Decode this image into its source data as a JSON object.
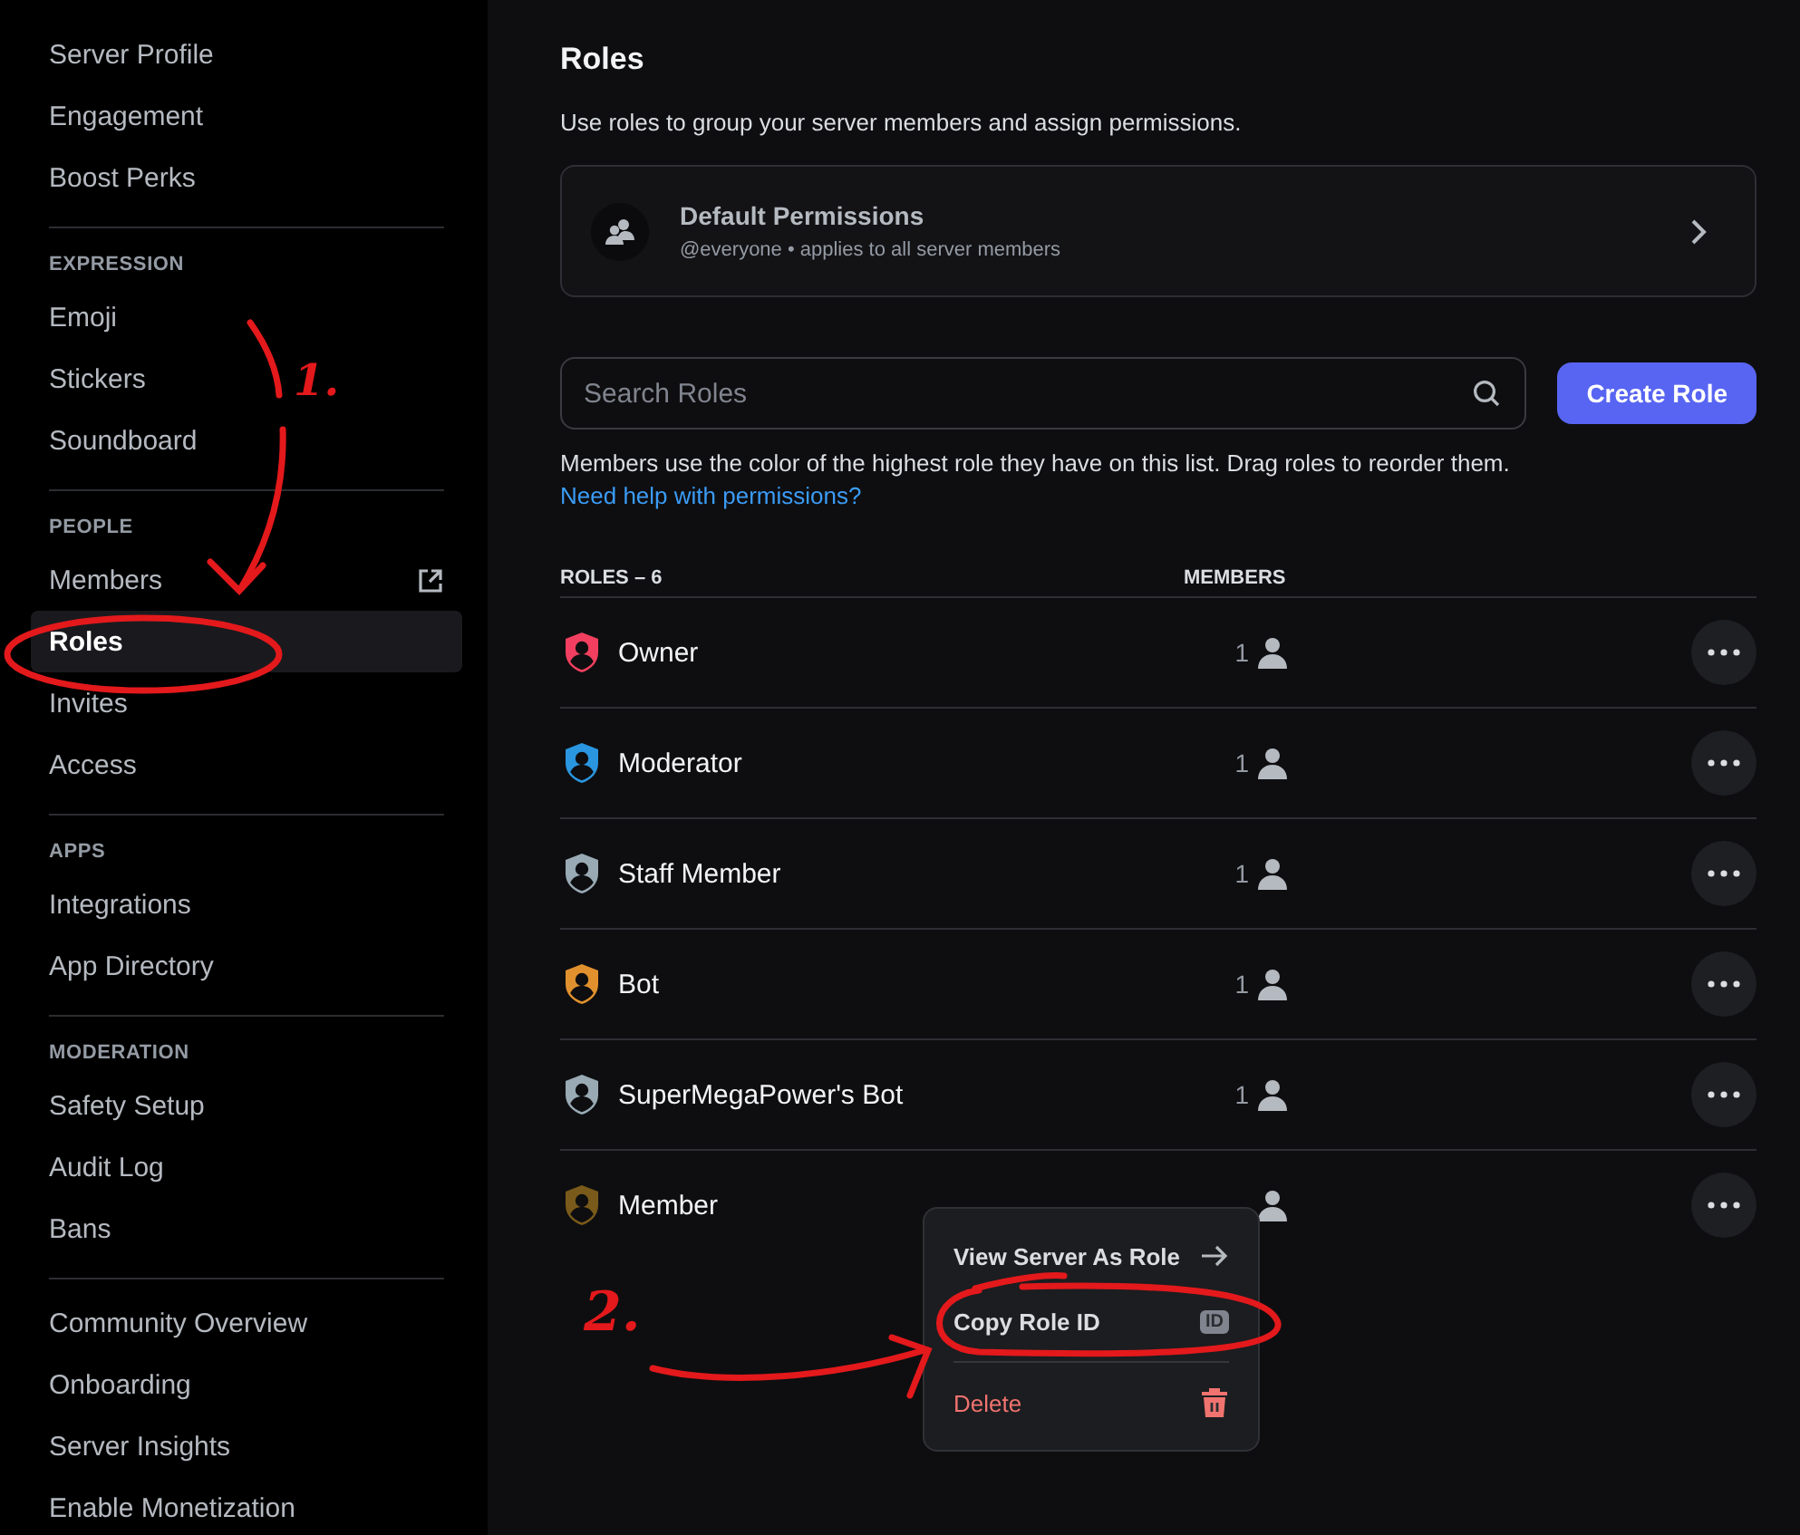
{
  "sidebar": {
    "groups": [
      {
        "items": [
          {
            "label": "Server Profile",
            "kind": "page",
            "selected": false
          },
          {
            "label": "Engagement",
            "kind": "page",
            "selected": false
          },
          {
            "label": "Boost Perks",
            "kind": "page",
            "selected": false
          }
        ]
      },
      {
        "header": "EXPRESSION",
        "items": [
          {
            "label": "Emoji",
            "kind": "page",
            "selected": false
          },
          {
            "label": "Stickers",
            "kind": "page",
            "selected": false
          },
          {
            "label": "Soundboard",
            "kind": "page",
            "selected": false
          }
        ]
      },
      {
        "header": "PEOPLE",
        "items": [
          {
            "label": "Members",
            "kind": "external",
            "selected": false
          },
          {
            "label": "Roles",
            "kind": "page",
            "selected": true
          },
          {
            "label": "Invites",
            "kind": "page",
            "selected": false
          },
          {
            "label": "Access",
            "kind": "page",
            "selected": false
          }
        ]
      },
      {
        "header": "APPS",
        "items": [
          {
            "label": "Integrations",
            "kind": "page",
            "selected": false
          },
          {
            "label": "App Directory",
            "kind": "page",
            "selected": false
          }
        ]
      },
      {
        "header": "MODERATION",
        "items": [
          {
            "label": "Safety Setup",
            "kind": "page",
            "selected": false
          },
          {
            "label": "Audit Log",
            "kind": "page",
            "selected": false
          },
          {
            "label": "Bans",
            "kind": "page",
            "selected": false
          }
        ]
      },
      {
        "items": [
          {
            "label": "Community Overview",
            "kind": "page",
            "selected": false
          },
          {
            "label": "Onboarding",
            "kind": "page",
            "selected": false
          },
          {
            "label": "Server Insights",
            "kind": "page",
            "selected": false
          },
          {
            "label": "Enable Monetization",
            "kind": "page",
            "selected": false
          }
        ]
      }
    ]
  },
  "main": {
    "title": "Roles",
    "description": "Use roles to group your server members and assign permissions.",
    "default_permissions": {
      "title": "Default Permissions",
      "subtitle": "@everyone • applies to all server members"
    },
    "search": {
      "placeholder": "Search Roles"
    },
    "create_button": "Create Role",
    "help_text": "Members use the color of the highest role they have on this list. Drag roles to reorder them.",
    "help_link": "Need help with permissions?",
    "table": {
      "columns": [
        "ROLES – 6",
        "MEMBERS"
      ],
      "rows": [
        {
          "name": "Owner",
          "color": "#f23f5f",
          "members": "1"
        },
        {
          "name": "Moderator",
          "color": "#2a96e0",
          "members": "1"
        },
        {
          "name": "Staff Member",
          "color": "#99aab5",
          "members": "1"
        },
        {
          "name": "Bot",
          "color": "#e0912e",
          "members": "1"
        },
        {
          "name": "SuperMegaPower's Bot",
          "color": "#99aab5",
          "members": "1"
        },
        {
          "name": "Member",
          "color": "#7a5a1a"
        }
      ]
    },
    "context_menu": {
      "items": [
        {
          "label": "View Server As Role",
          "kind": "arrow"
        },
        {
          "label": "Copy Role ID",
          "kind": "id",
          "badge": "ID"
        },
        {
          "label": "Delete",
          "kind": "danger"
        }
      ]
    }
  },
  "annotations": [
    {
      "label": "1."
    },
    {
      "label": "2."
    }
  ]
}
